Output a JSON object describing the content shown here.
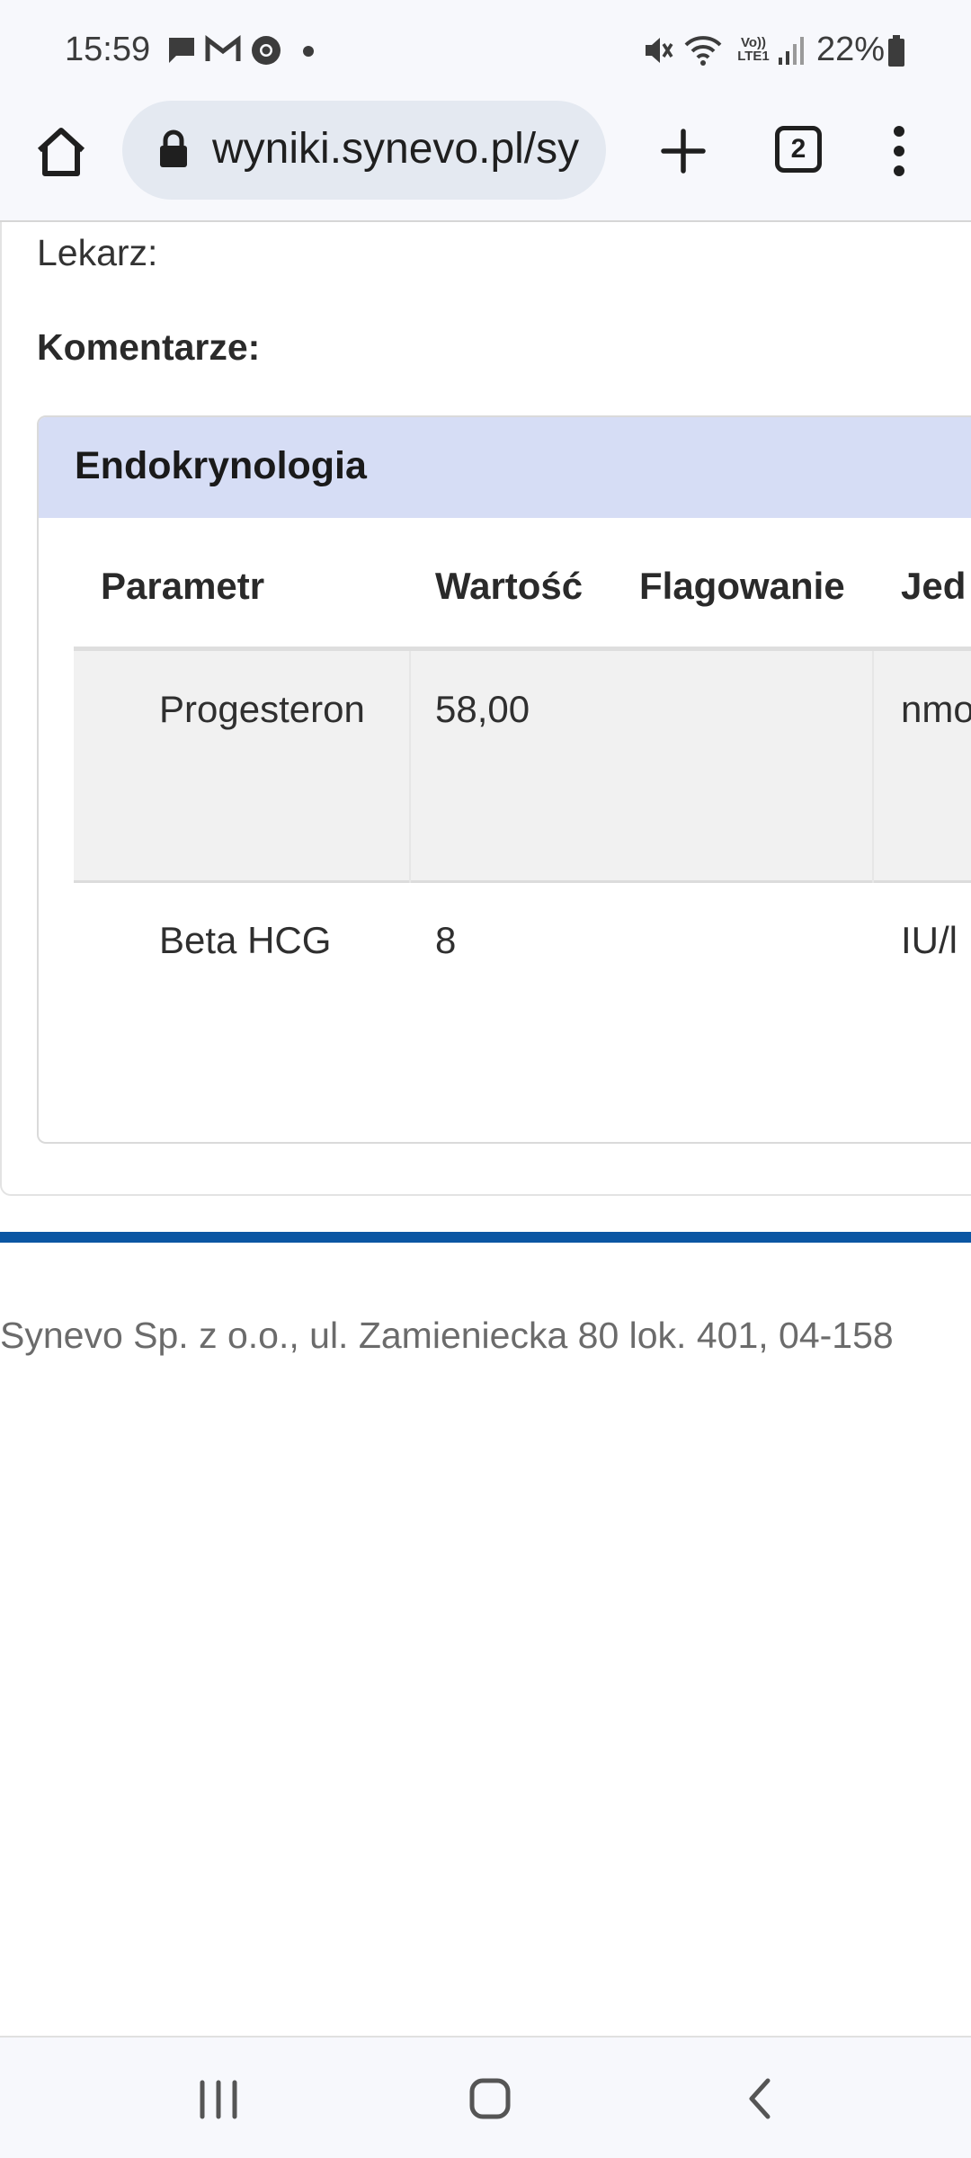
{
  "status_bar": {
    "time": "15:59",
    "battery": "22%",
    "icons": [
      "message-icon",
      "gmail-icon",
      "chrome-icon",
      "dot-icon",
      "mute-icon",
      "wifi-icon",
      "volte-icon",
      "signal-icon",
      "battery-icon"
    ],
    "volte_top": "Vo))",
    "volte_bottom": "LTE1"
  },
  "browser": {
    "url": "wyniki.synevo.pl/sy",
    "tab_count": "2"
  },
  "page": {
    "doctor_label": "Lekarz:",
    "comments_label": "Komentarze:",
    "section_title": "Endokrynologia",
    "table": {
      "headers": [
        "Parametr",
        "Wartość",
        "Flagowanie",
        "Jed"
      ],
      "rows": [
        {
          "parameter": "Progesteron",
          "value": "58,00",
          "flag": "",
          "unit": "nmo"
        },
        {
          "parameter": "Beta HCG",
          "value": "8",
          "flag": "",
          "unit": "IU/l"
        }
      ]
    },
    "footer": "Synevo Sp. z o.o., ul. Zamieniecka 80 lok. 401, 04-158"
  },
  "colors": {
    "section_header_bg": "#d6ddf5",
    "accent_rule": "#0b56a3",
    "url_bar_bg": "#e4e9f1"
  }
}
